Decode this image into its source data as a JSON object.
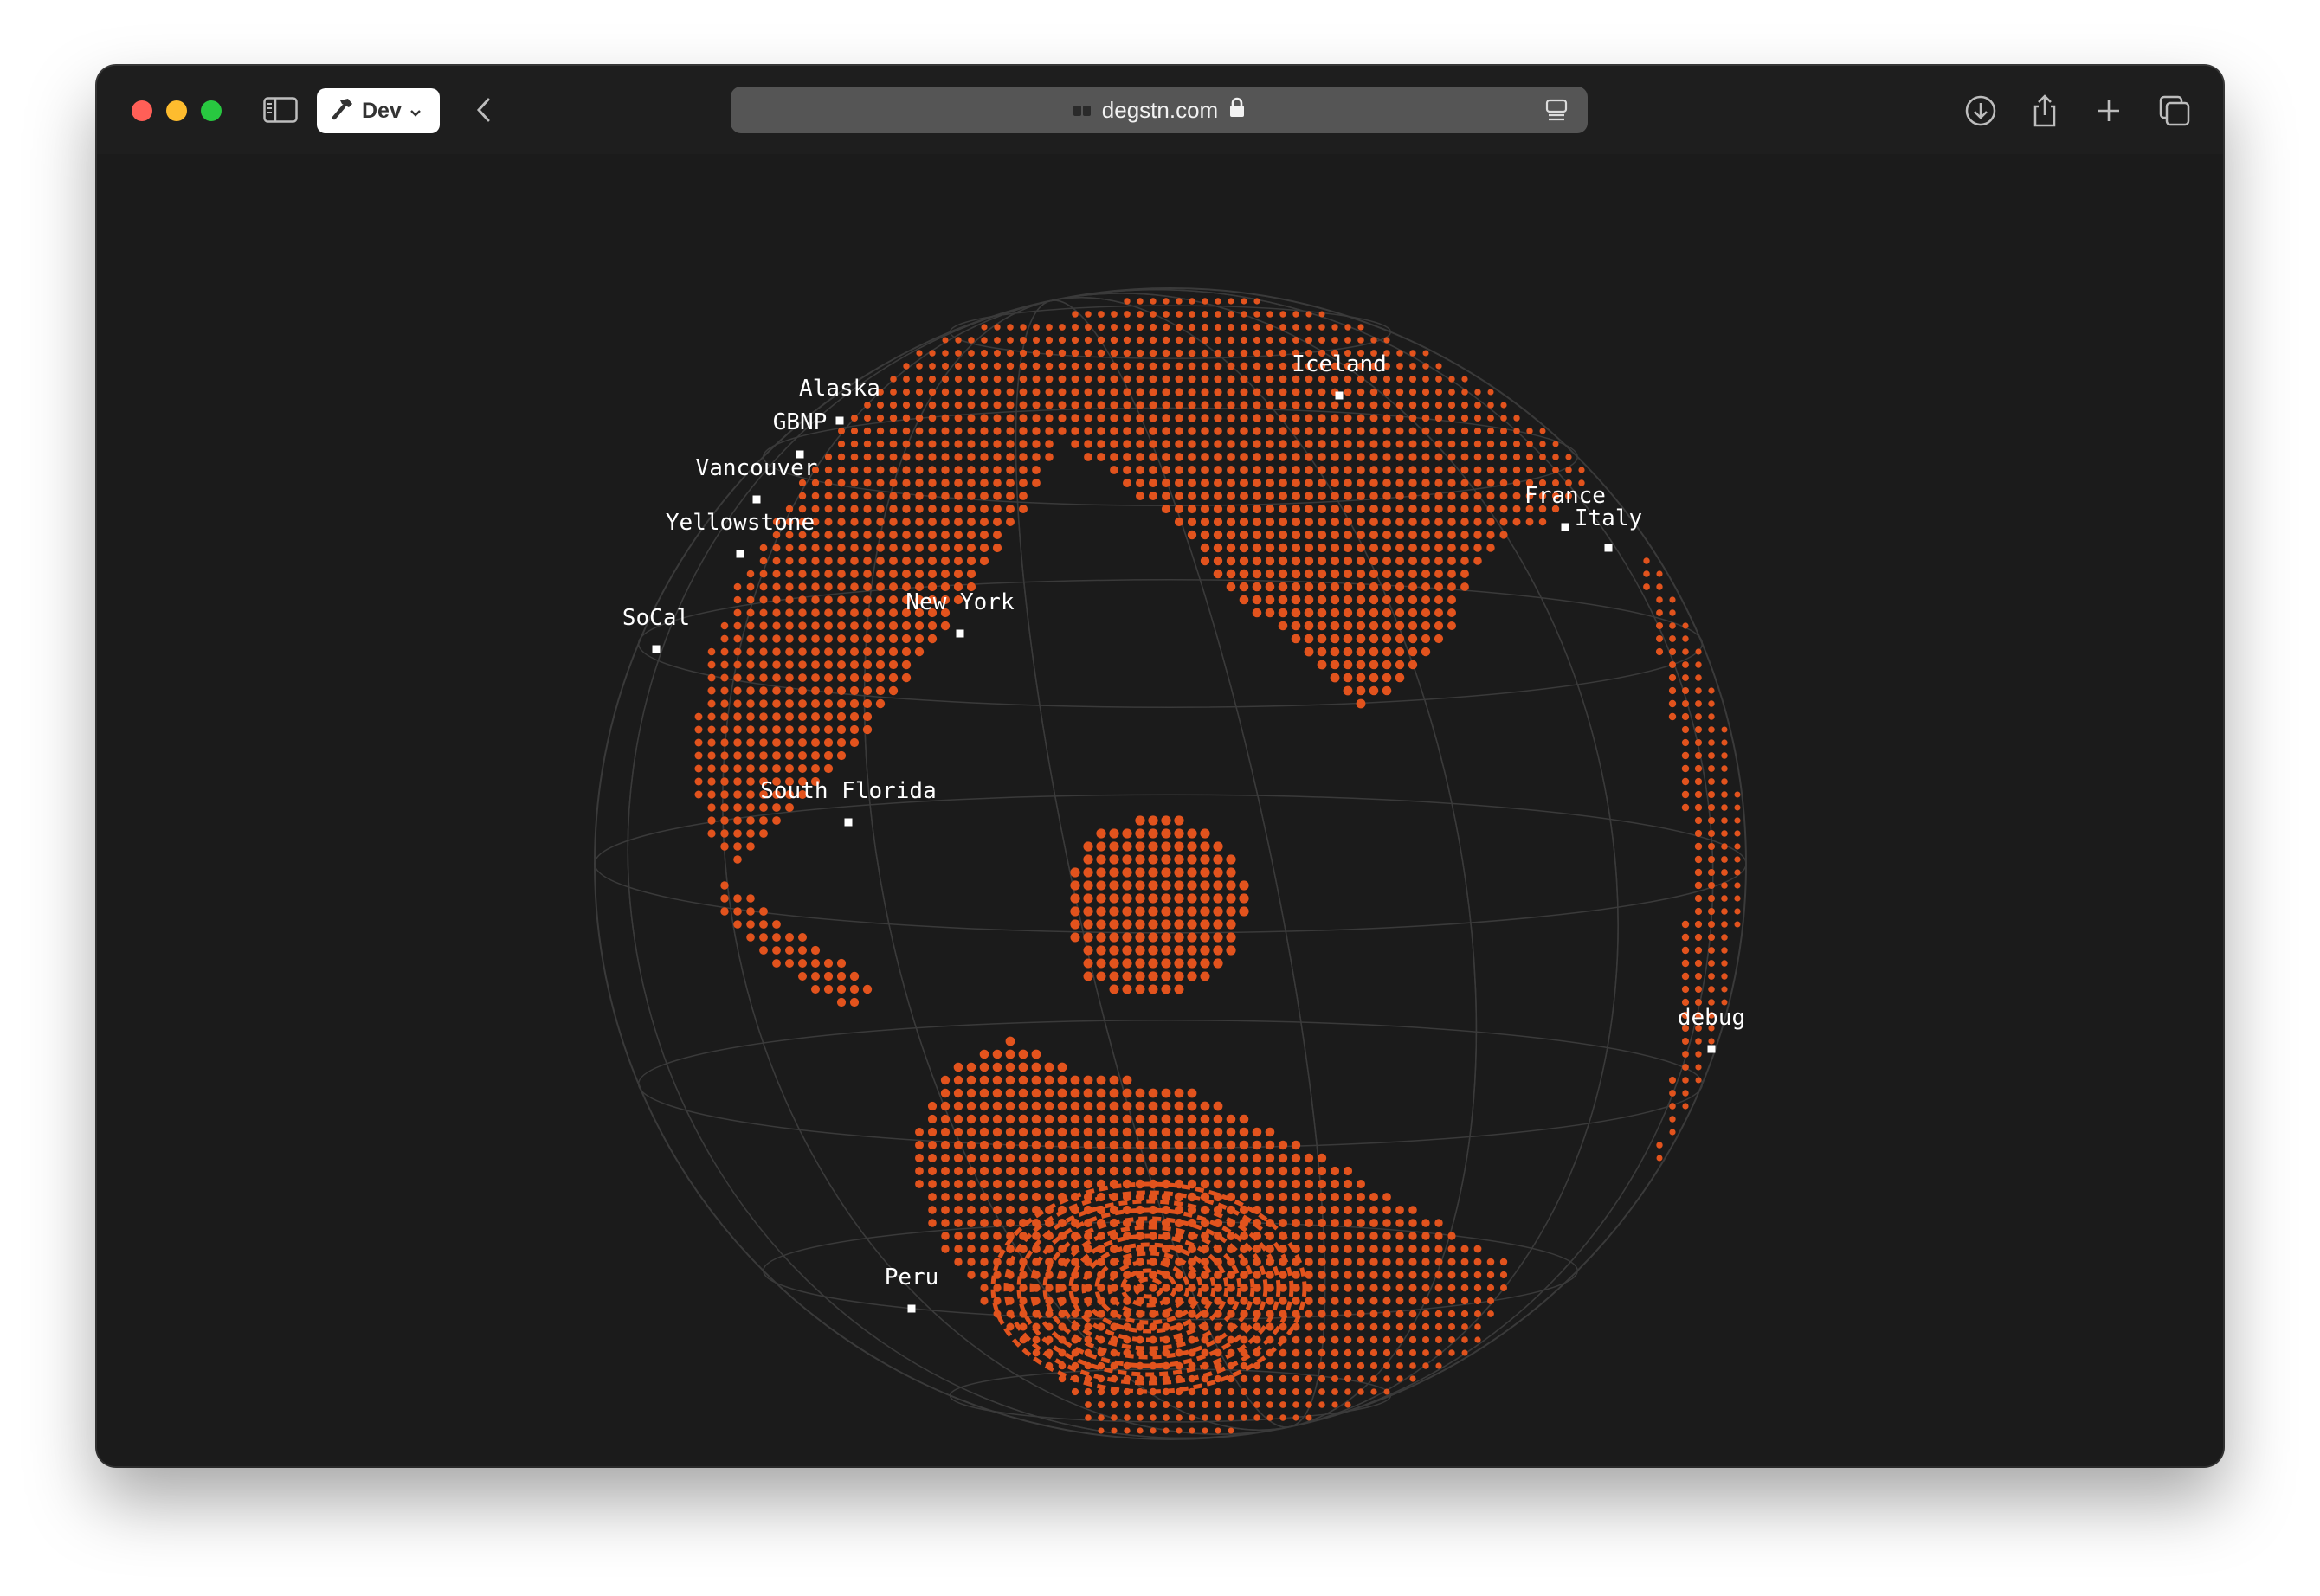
{
  "browser": {
    "dev_button_label": "Dev",
    "url": "degstn.com"
  },
  "globe": {
    "dot_color": "#e2531d",
    "grid_color": "#3a3a3a",
    "background": "#1b1b1b"
  },
  "locations": [
    {
      "name": "Alaska"
    },
    {
      "name": "GBNP"
    },
    {
      "name": "Vancouver"
    },
    {
      "name": "Yellowstone"
    },
    {
      "name": "SoCal"
    },
    {
      "name": "New York"
    },
    {
      "name": "South Florida"
    },
    {
      "name": "Iceland"
    },
    {
      "name": "France"
    },
    {
      "name": "Italy"
    },
    {
      "name": "debug"
    },
    {
      "name": "Peru"
    }
  ]
}
